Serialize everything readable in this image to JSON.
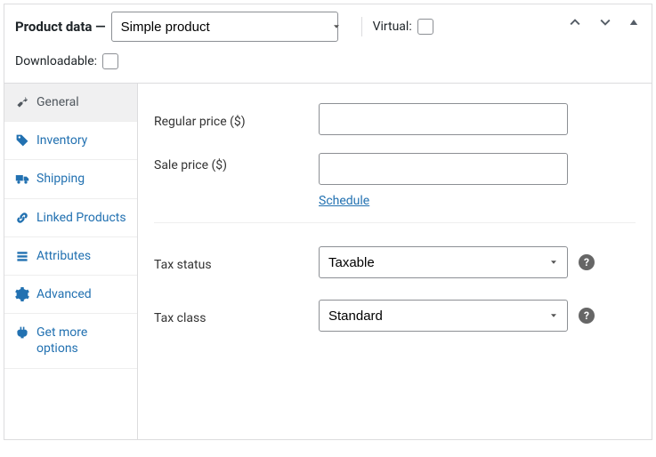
{
  "header": {
    "title": "Product data —",
    "product_type": "Simple product",
    "virtual_label": "Virtual:",
    "downloadable_label": "Downloadable:"
  },
  "tabs": [
    {
      "key": "general",
      "label": "General",
      "active": true
    },
    {
      "key": "inventory",
      "label": "Inventory",
      "active": false
    },
    {
      "key": "shipping",
      "label": "Shipping",
      "active": false
    },
    {
      "key": "linked-products",
      "label": "Linked Products",
      "active": false
    },
    {
      "key": "attributes",
      "label": "Attributes",
      "active": false
    },
    {
      "key": "advanced",
      "label": "Advanced",
      "active": false
    },
    {
      "key": "get-more-options",
      "label": "Get more options",
      "active": false
    }
  ],
  "fields": {
    "regular_price_label": "Regular price ($)",
    "regular_price_value": "",
    "sale_price_label": "Sale price ($)",
    "sale_price_value": "",
    "schedule_link": "Schedule",
    "tax_status_label": "Tax status",
    "tax_status_value": "Taxable",
    "tax_class_label": "Tax class",
    "tax_class_value": "Standard"
  }
}
